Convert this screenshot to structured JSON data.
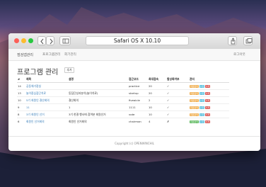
{
  "browser": {
    "address": "Safari OS X 10.10"
  },
  "nav": {
    "brand": "점검앱관리",
    "items": [
      "프로그램관리",
      "회기관리"
    ],
    "logout": "로그아웃"
  },
  "page": {
    "title": "프로그램 관리",
    "add_label": "추가"
  },
  "table": {
    "headers": [
      "#",
      "제목",
      "설명",
      "접근코드",
      "최대접속",
      "활성화여부",
      "관리"
    ],
    "rows": [
      [
        "14",
        "공동체가정실",
        "",
        "practice",
        "20",
        "✓"
      ],
      [
        "13",
        "놀이중심집단치료",
        "동집단성과분석(놀이치료)",
        "startup",
        "20",
        "✓"
      ],
      [
        "10",
        "5기 회원인 결산회의",
        "결산회의",
        "fiveaicle",
        "2",
        "✓"
      ],
      [
        "9",
        "11",
        "1",
        "1111",
        "10",
        "✓"
      ],
      [
        "8",
        "3기 회원인 선거",
        "3기 한결 행사에 참여분 회원선거",
        "vote",
        "10",
        "✓"
      ],
      [
        "6",
        "회원인 선거회의",
        "회원인 선거회의",
        "chairman",
        "4",
        "✗"
      ]
    ],
    "actions": [
      "회원관리",
      "수정",
      "삭제"
    ]
  },
  "footer": {
    "copyright": "Copyright (c) OPENWINCHIL"
  },
  "colors": {
    "close": "#fc5f57",
    "minimize": "#fdbc2e",
    "zoom": "#28c840",
    "act_orange": "#f0ad4e",
    "act_blue": "#5bc0de",
    "act_red": "#d9534f",
    "act_green": "#5cb85c",
    "link": "#337ab7"
  }
}
